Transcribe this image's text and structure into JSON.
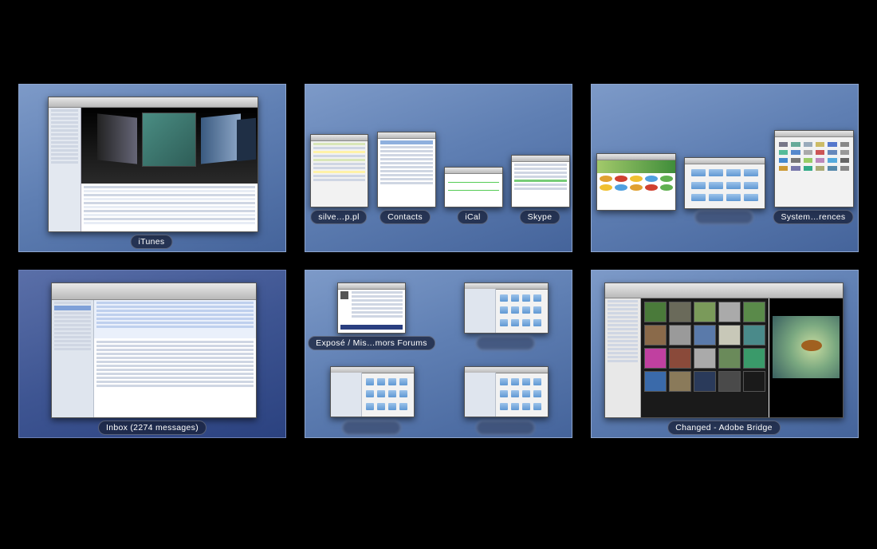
{
  "spaces": [
    {
      "label": "iTunes"
    },
    {
      "labels": [
        "silve…p.pl",
        "Contacts",
        "iCal",
        "Skype"
      ]
    },
    {
      "labels": [
        "System…rences"
      ]
    },
    {
      "label": "Inbox (2274 messages)"
    },
    {
      "labels": [
        "Exposé / Mis…mors Forums"
      ]
    },
    {
      "label": "Changed - Adobe Bridge"
    }
  ],
  "colors": {
    "desktop_background": "#000000",
    "space_gradient_top": "#7d9ac8",
    "space_gradient_bottom": "#45649b"
  }
}
